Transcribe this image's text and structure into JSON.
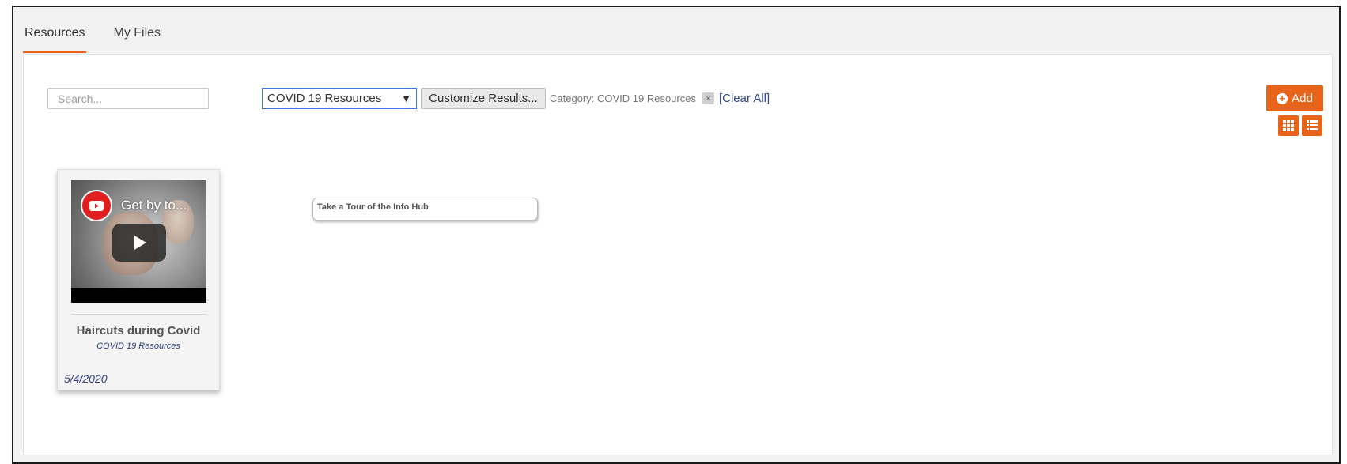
{
  "tabs": [
    {
      "label": "Resources",
      "active": true
    },
    {
      "label": "My Files",
      "active": false
    }
  ],
  "toolbar": {
    "search_placeholder": "Search...",
    "category_select_value": "COVID 19 Resources",
    "customize_label": "Customize Results...",
    "category_filter_label": "Category: COVID 19 Resources",
    "remove_filter_glyph": "×",
    "clear_all_label": "[Clear All]",
    "add_label": "Add"
  },
  "resources": [
    {
      "video_title": "Get by to...",
      "title": "Haircuts during Covid",
      "category": "COVID 19 Resources",
      "date": "5/4/2020"
    }
  ],
  "tooltip": {
    "text": "Take a Tour of the Info Hub"
  },
  "colors": {
    "accent": "#e8641b",
    "link": "#2f4a8a",
    "youtube_red": "#e02020"
  },
  "icons": [
    "plus-circle-icon",
    "grid-view-icon",
    "list-view-icon",
    "youtube-icon",
    "play-icon",
    "dropdown-arrow-icon",
    "close-icon"
  ]
}
